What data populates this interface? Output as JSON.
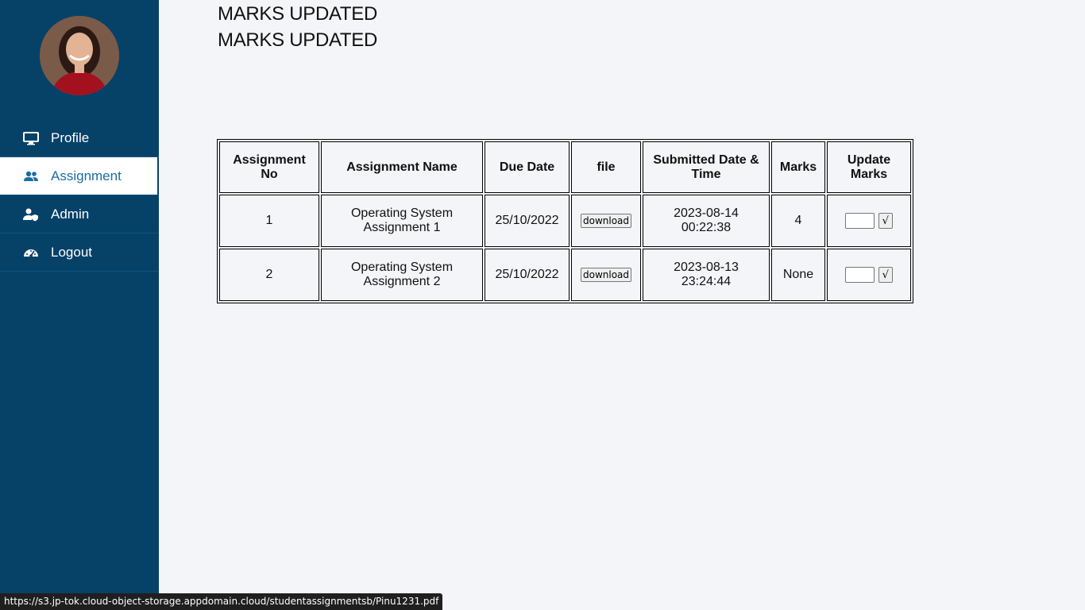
{
  "sidebar": {
    "avatar_icon": "user-avatar-photo",
    "items": [
      {
        "label": "Profile",
        "icon": "monitor-icon",
        "active": false
      },
      {
        "label": "Assignment",
        "icon": "users-icon",
        "active": true
      },
      {
        "label": "Admin",
        "icon": "user-shield-icon",
        "active": false
      },
      {
        "label": "Logout",
        "icon": "gauge-icon",
        "active": false
      }
    ]
  },
  "messages": [
    "MARKS UPDATED",
    "MARKS UPDATED"
  ],
  "table": {
    "headers": [
      "Assignment No",
      "Assignment Name",
      "Due Date",
      "file",
      "Submitted Date & Time",
      "Marks",
      "Update Marks"
    ],
    "rows": [
      {
        "no": "1",
        "name": "Operating System Assignment 1",
        "due": "25/10/2022",
        "file_button": "download",
        "submitted": "2023-08-14 00:22:38",
        "marks": "4",
        "submit_button": "√"
      },
      {
        "no": "2",
        "name": "Operating System Assignment 2",
        "due": "25/10/2022",
        "file_button": "download",
        "submitted": "2023-08-13 23:24:44",
        "marks": "None",
        "submit_button": "√"
      }
    ]
  },
  "status_bar": {
    "url": "https://s3.jp-tok.cloud-object-storage.appdomain.cloud/studentassignmentsb/Pinu1231.pdf"
  },
  "colors": {
    "sidebar_bg": "#064168",
    "active_text": "#1a6da3",
    "page_bg": "#f4f5f9"
  }
}
